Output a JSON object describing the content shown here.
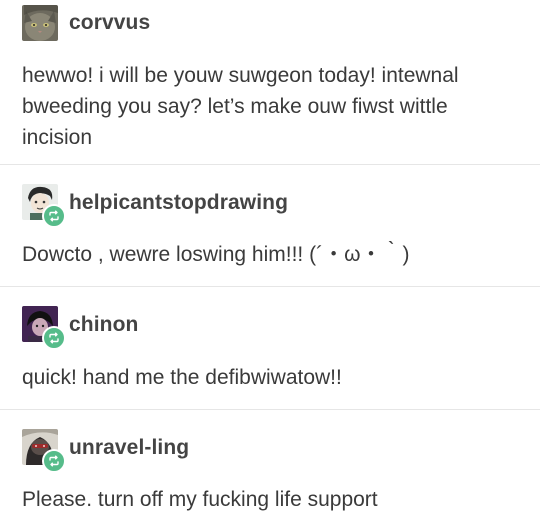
{
  "posts": [
    {
      "username": "corvvus",
      "text": "hewwo! i will be youw suwgeon today! intewnal bweeding you say? let’s make ouw fiwst wittle incision",
      "reblog": false,
      "avatar_icon": "cat-photo-avatar"
    },
    {
      "username": "helpicantstopdrawing",
      "text": "Dowcto , wewre loswing him!!! (´・ω・｀)",
      "reblog": true,
      "avatar_icon": "drawn-character-avatar"
    },
    {
      "username": "chinon",
      "text": "quick! hand me the defibwiwatow!!",
      "reblog": true,
      "avatar_icon": "dark-character-avatar"
    },
    {
      "username": "unravel-ling",
      "text": "Please. turn off my fucking life support",
      "reblog": true,
      "avatar_icon": "masked-character-avatar"
    }
  ],
  "colors": {
    "reblog_badge": "#56bc8a",
    "divider": "#e6e6e6",
    "text": "#3a3a3a"
  }
}
